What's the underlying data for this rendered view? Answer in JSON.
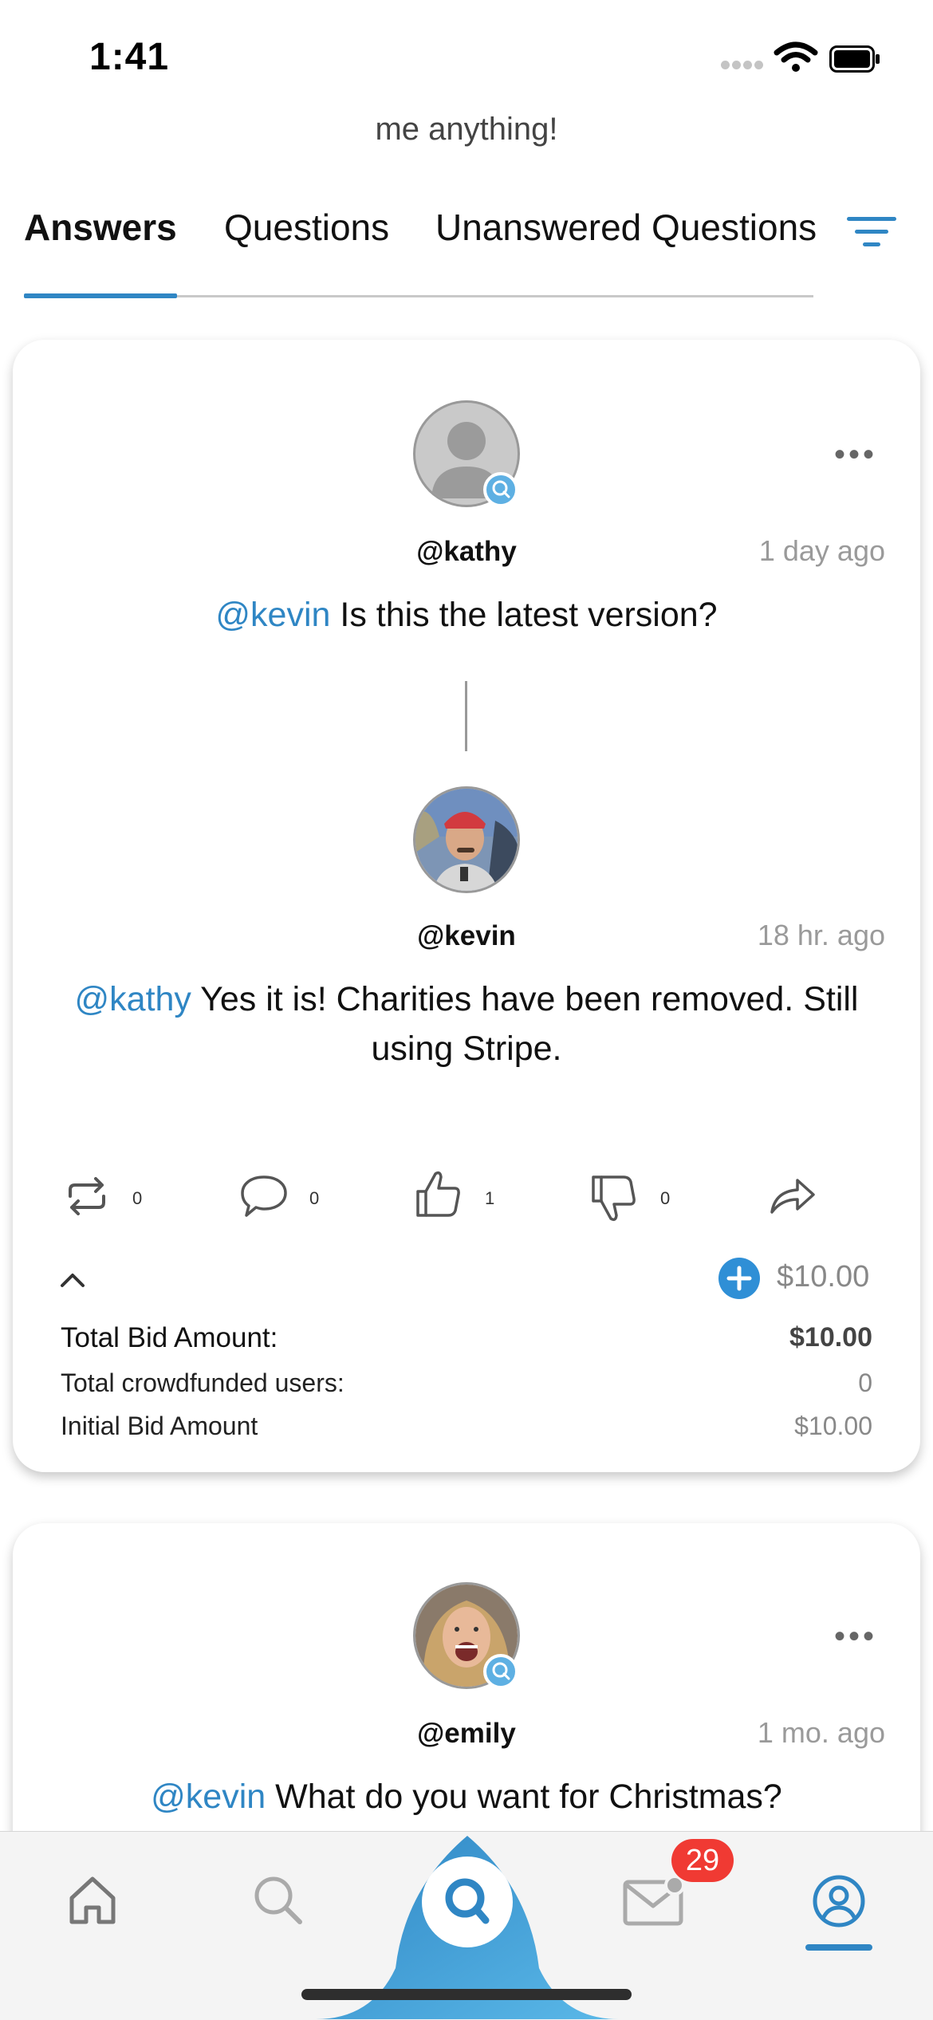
{
  "status_bar": {
    "time": "1:41"
  },
  "header": {
    "subtitle": "me anything!"
  },
  "tabs": [
    {
      "label": "Answers",
      "active": true
    },
    {
      "label": "Questions",
      "active": false
    },
    {
      "label": "Unanswered Questions",
      "active": false
    }
  ],
  "accent_color": "#2f86c4",
  "cards": [
    {
      "question": {
        "handle": "@kathy",
        "time": "1 day ago",
        "mention": "@kevin",
        "text": " Is this the latest version?"
      },
      "answer": {
        "handle": "@kevin",
        "time": "18 hr. ago",
        "mention": "@kathy",
        "text": " Yes it is! Charities have been removed. Still using Stripe."
      },
      "actions": {
        "reposts": "0",
        "comments": "0",
        "likes": "1",
        "dislikes": "0"
      },
      "bid": {
        "amount_display": "$10.00",
        "total_label": "Total Bid Amount:",
        "total_value": "$10.00",
        "crowdfunded_label": "Total crowdfunded users:",
        "crowdfunded_value": "0",
        "initial_label": "Initial Bid Amount",
        "initial_value": "$10.00"
      }
    },
    {
      "question": {
        "handle": "@emily",
        "time": "1 mo. ago",
        "mention": "@kevin",
        "text": " What do you want for Christmas?"
      }
    }
  ],
  "bottom_nav": {
    "items": [
      "home-icon",
      "search-icon",
      "ask-icon",
      "mail-icon",
      "profile-icon"
    ],
    "mail_badge": "29"
  }
}
